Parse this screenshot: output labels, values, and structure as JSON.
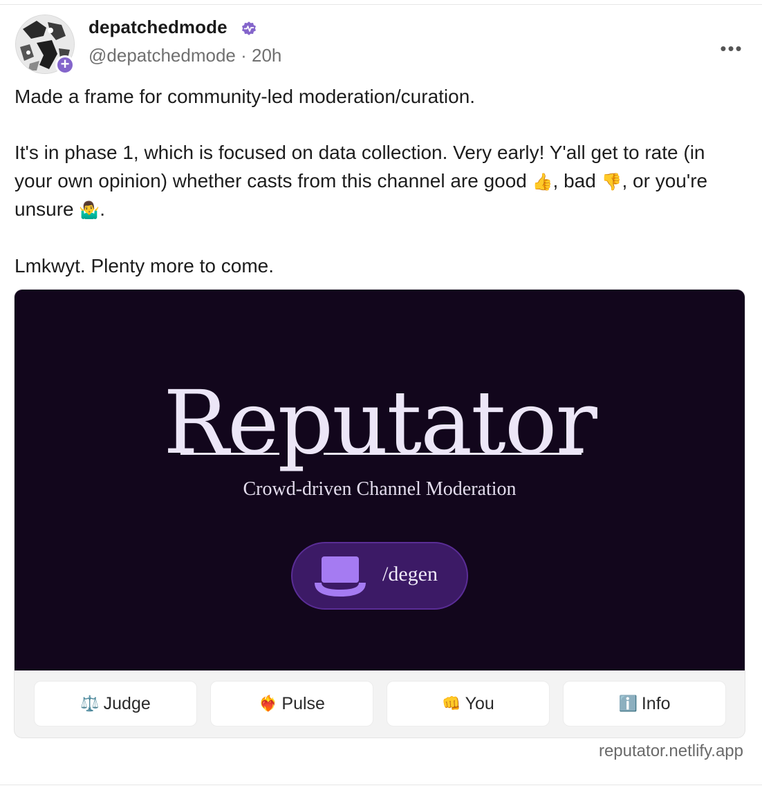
{
  "author": {
    "display_name": "depatchedmode",
    "handle": "@depatchedmode",
    "separator": "·",
    "time_ago": "20h",
    "verified_color": "#8465cb"
  },
  "post": {
    "paragraphs": [
      {
        "text": "Made a frame for community-led moderation/curation."
      },
      {
        "segments": [
          "It's in phase 1, which is focused on data collection. Very early! Y'all get to rate (in your own opinion) whether casts from this channel are good ",
          "👍",
          ", bad ",
          "👎",
          ", or you're unsure ",
          "🤷‍♂️",
          "."
        ]
      },
      {
        "text": "Lmkwyt. Plenty more to come."
      }
    ]
  },
  "frame": {
    "title": "Reputator",
    "subtitle": "Crowd-driven Channel Moderation",
    "channel": "/degen",
    "background_color": "#12061c",
    "accent_color": "#a57bf2",
    "buttons": [
      {
        "icon": "⚖️",
        "icon_name": "scales-icon",
        "label": "Judge"
      },
      {
        "icon": "❤️‍🔥",
        "icon_name": "heart-on-fire-icon",
        "label": "Pulse"
      },
      {
        "icon": "👊",
        "icon_name": "fist-icon",
        "label": "You"
      },
      {
        "icon": "ℹ️",
        "icon_name": "info-icon",
        "label": "Info"
      }
    ],
    "domain": "reputator.netlify.app"
  }
}
